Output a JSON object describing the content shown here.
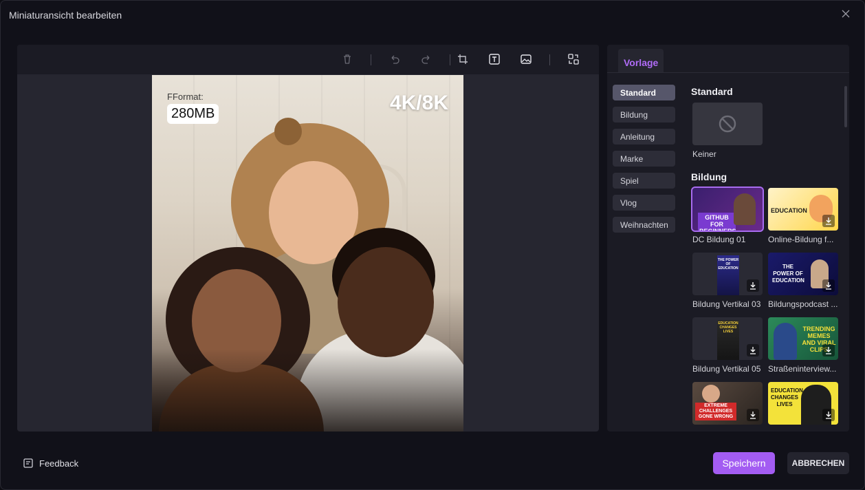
{
  "dialog": {
    "title": "Miniaturansicht bearbeiten",
    "close_icon": "close-icon"
  },
  "toolbar": {
    "icons": [
      "delete-icon",
      "undo-icon",
      "redo-icon",
      "crop-icon",
      "text-icon",
      "image-icon",
      "replace-icon"
    ]
  },
  "canvas": {
    "format_label": "FFormat:",
    "size_value": "280MB",
    "resolution": "4K/8K"
  },
  "panel": {
    "tab": "Vorlage",
    "categories": [
      {
        "label": "Standard",
        "active": true
      },
      {
        "label": "Bildung",
        "active": false
      },
      {
        "label": "Anleitung",
        "active": false
      },
      {
        "label": "Marke",
        "active": false
      },
      {
        "label": "Spiel",
        "active": false
      },
      {
        "label": "Vlog",
        "active": false
      },
      {
        "label": "Weihnachten",
        "active": false
      }
    ],
    "sections": {
      "standard": {
        "title": "Standard",
        "items": [
          {
            "label": "Keiner"
          }
        ]
      },
      "bildung": {
        "title": "Bildung",
        "items": [
          {
            "label": "DC Bildung 01",
            "thumb_text": "GITHUB\nFOR BEGINNERS"
          },
          {
            "label": "Online-Bildung f...",
            "thumb_text": "EDUCATION"
          },
          {
            "label": "Bildung Vertikal 03",
            "thumb_text": "THE POWER OF EDUCATION"
          },
          {
            "label": "Bildungspodcast ...",
            "thumb_text": "THE POWER OF EDUCATION"
          },
          {
            "label": "Bildung Vertikal 05",
            "thumb_text": "EDUCATION CHANGES LIVES"
          },
          {
            "label": "Straßeninterview...",
            "thumb_text": "TRENDING MEMES AND VIRAL CLIPS"
          },
          {
            "label": "",
            "thumb_text": "EXTREME CHALLENGES GONE WRONG"
          },
          {
            "label": "",
            "thumb_text": "EDUCATION CHANGES LIVES"
          }
        ]
      }
    }
  },
  "footer": {
    "feedback": "Feedback",
    "save": "Speichern",
    "cancel": "ABBRECHEN"
  },
  "colors": {
    "accent": "#a35cf2",
    "tab_text": "#b06cf7",
    "background": "#111119"
  }
}
